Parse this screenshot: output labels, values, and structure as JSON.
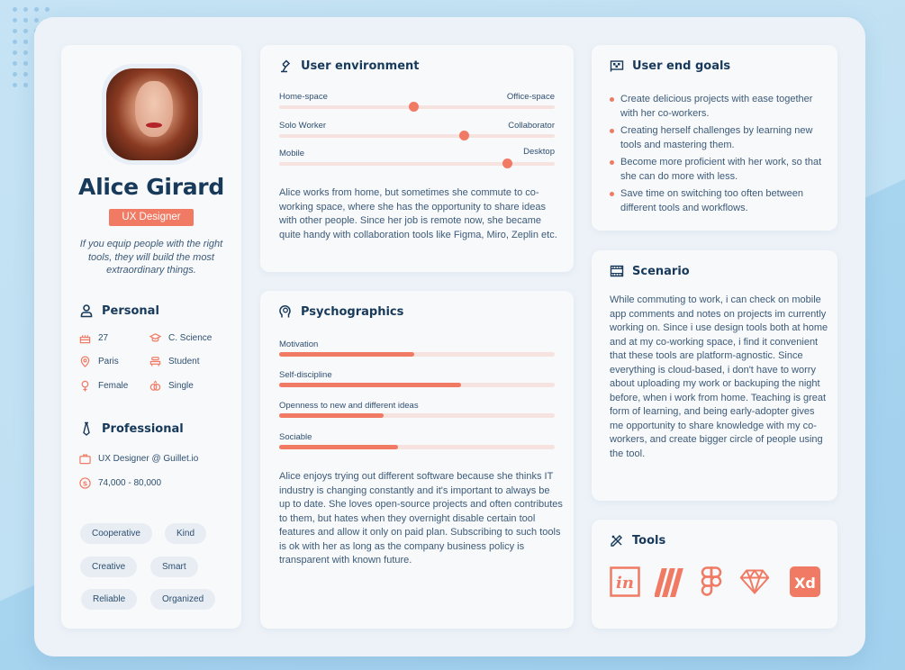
{
  "profile": {
    "name": "Alice Girard",
    "role": "UX Designer",
    "quote": "If you equip people with the right tools, they will build the most extraordinary things.",
    "personal": {
      "title": "Personal",
      "items": [
        {
          "icon": "birthday-cake-icon",
          "label": "27"
        },
        {
          "icon": "graduation-cap-icon",
          "label": "C. Science"
        },
        {
          "icon": "location-pin-icon",
          "label": "Paris"
        },
        {
          "icon": "student-icon",
          "label": "Student"
        },
        {
          "icon": "female-icon",
          "label": "Female"
        },
        {
          "icon": "rings-icon",
          "label": "Single"
        }
      ]
    },
    "professional": {
      "title": "Professional",
      "items": [
        {
          "icon": "briefcase-icon",
          "label": "UX Designer @ Guillet.io"
        },
        {
          "icon": "dollar-coin-icon",
          "label": "74,000 - 80,000"
        }
      ]
    },
    "traits": [
      "Cooperative",
      "Kind",
      "Creative",
      "Smart",
      "Reliable",
      "Organized"
    ]
  },
  "environment": {
    "title": "User environment",
    "sliders": [
      {
        "left": "Home-space",
        "right": "Office-space",
        "value": 0.49
      },
      {
        "left": "Solo Worker",
        "right": "Collaborator",
        "value": 0.67
      },
      {
        "left": "Mobile",
        "right": "Desktop",
        "value": 0.83
      }
    ],
    "description": "Alice works from home, but sometimes she commute to co-working space, where she has the opportunity to share ideas with other people. Since her job is remote now, she became quite handy with collaboration tools like Figma, Miro, Zeplin etc."
  },
  "psychographics": {
    "title": "Psychographics",
    "bars": [
      {
        "label": "Motivation",
        "value": 0.49
      },
      {
        "label": "Self-discipline",
        "value": 0.66
      },
      {
        "label": "Openness to new and different ideas",
        "value": 0.38
      },
      {
        "label": "Sociable",
        "value": 0.43
      }
    ],
    "description": "Alice enjoys trying out different software because she thinks IT industry is changing constantly and it's important to always be up to date. She loves open-source projects and often contributes to them, but hates when they overnight disable certain tool features and allow it only on paid plan. Subscribing to such tools is ok with her as long as the company business policy is transparent with known future."
  },
  "goals": {
    "title": "User end goals",
    "items": [
      "Create delicious projects with ease together with her co-workers.",
      "Creating herself challenges by learning new tools and mastering them.",
      "Become more proficient with her work, so that she can do more with less.",
      "Save time on switching too often between different tools and workflows."
    ]
  },
  "scenario": {
    "title": "Scenario",
    "text": "While commuting to work, i can check on mobile app comments and notes on projects im currently working on. Since i use design tools both at home and at my co-working space, i find it convenient that these tools are platform-agnostic. Since everything is cloud-based, i don't have to worry about uploading my work or backuping the night before, when i work from home. Teaching is great form of learning, and being early-adopter gives me opportunity to share knowledge with my co-workers, and create bigger circle of people using the tool."
  },
  "tools": {
    "title": "Tools",
    "items": [
      "invision-icon",
      "miro-icon",
      "figma-icon",
      "sketch-icon",
      "adobe-xd-icon"
    ],
    "xd_label": "Xd",
    "invision_label": "in"
  },
  "colors": {
    "accent": "#f07a63",
    "navy": "#17395a",
    "text": "#3b5a78",
    "background": "#c5e3f4"
  }
}
